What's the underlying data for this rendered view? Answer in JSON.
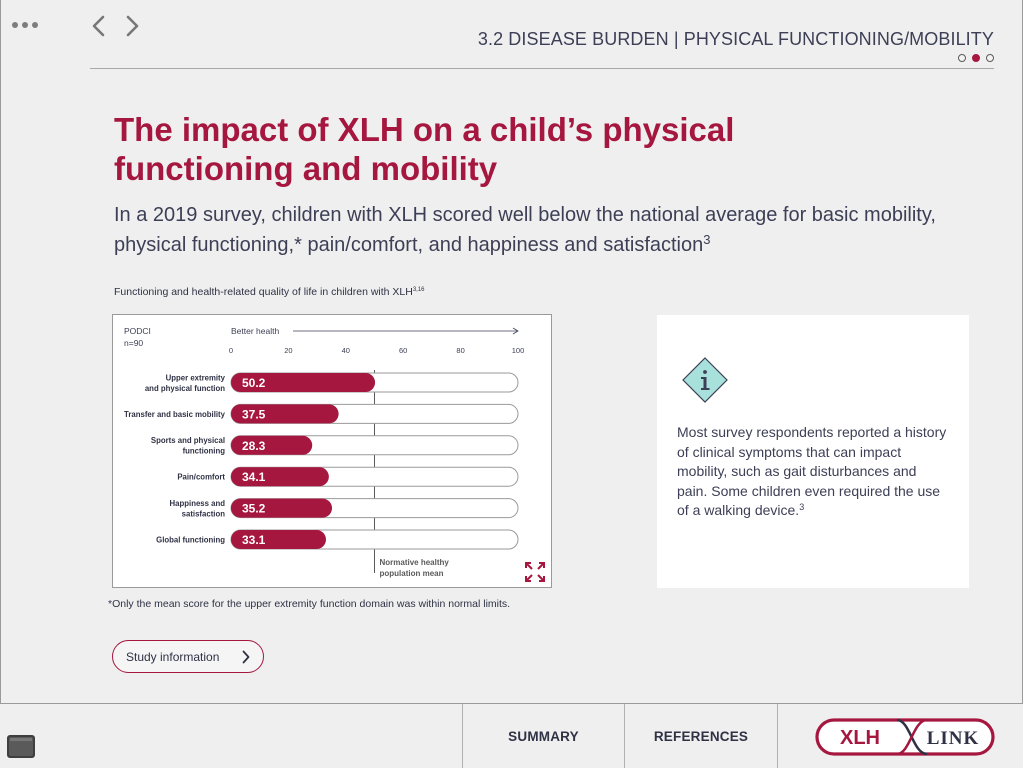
{
  "header": {
    "section_title": "3.2 DISEASE BURDEN | PHYSICAL FUNCTIONING/MOBILITY",
    "pager": {
      "total": 3,
      "active_index": 1
    }
  },
  "main": {
    "headline": "The impact of XLH on a child’s physical functioning and mobility",
    "subhead": "In a 2019 survey, children with XLH scored well below the national average for basic mobility, physical functioning,* pain/comfort, and happiness and satisfaction",
    "subhead_ref": "3",
    "chart_caption": "Functioning and health-related quality of life in children with XLH",
    "chart_caption_ref": "3,16",
    "footnote": "*Only the mean score for the upper extremity function domain was within normal limits.",
    "study_button_label": "Study information"
  },
  "chart_data": {
    "type": "bar",
    "orientation": "horizontal",
    "instrument": "PODCI",
    "n": "n=90",
    "direction_label": "Better health",
    "categories": [
      [
        "Upper extremity",
        "and physical function"
      ],
      [
        "Transfer and basic mobility"
      ],
      [
        "Sports and physical",
        "functioning"
      ],
      [
        "Pain/comfort"
      ],
      [
        "Happiness and",
        "satisfaction"
      ],
      [
        "Global functioning"
      ]
    ],
    "values": [
      50.2,
      37.5,
      28.3,
      34.1,
      35.2,
      33.1
    ],
    "value_labels": [
      "50.2",
      "37.5",
      "28.3",
      "34.1",
      "35.2",
      "33.1"
    ],
    "xlim": [
      0,
      100
    ],
    "ticks": [
      0,
      20,
      40,
      60,
      80,
      100
    ],
    "reference_line": {
      "value": 50,
      "label": [
        "Normative healthy",
        "population mean"
      ]
    },
    "bar_color": "#a6173f",
    "grid": false
  },
  "info_card": {
    "text": "Most survey respondents reported a history of clinical symptoms that can impact mobility, such as gait disturbances and pain. Some children even required the use of a walking device.",
    "ref": "3",
    "icon": "info-diamond-icon",
    "icon_color": "#a8e0dc"
  },
  "bottom_bar": {
    "summary_label": "SUMMARY",
    "references_label": "REFERENCES",
    "logo_left": "XLH",
    "logo_right": "LINK"
  },
  "colors": {
    "accent": "#a6173f",
    "text": "#3c3f55",
    "background": "#efefef"
  }
}
